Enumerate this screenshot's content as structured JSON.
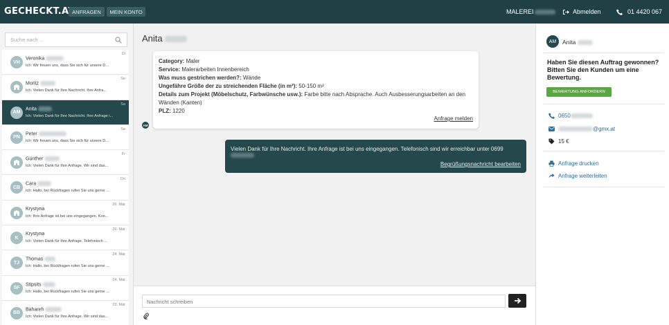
{
  "header": {
    "logo": "GECHECKT.AT",
    "nav": [
      "ANFRAGEN",
      "MEIN KONTO"
    ],
    "company_prefix": "MALEREI",
    "logout_label": "Abmelden",
    "phone": "01 4420 067"
  },
  "sidebar": {
    "search_placeholder": "Suche nach ...",
    "items": [
      {
        "initials": "VH",
        "name": "Veronika",
        "preview": "Ich: Wir freuen uns, dass Sie sich für unsere D...",
        "date": "Di",
        "avatar": "initials"
      },
      {
        "initials": "",
        "name": "Moritz",
        "preview": "Ich: Vielen Dank für Ihre Nachricht. Ihre Anfra...",
        "date": "So",
        "avatar": "building-icon"
      },
      {
        "initials": "AM",
        "name": "Anita",
        "preview": "Ich: Vielen Dank für Ihre Nachricht. Ihre Anfrage i...",
        "date": "Sa",
        "avatar": "initials",
        "active": true
      },
      {
        "initials": "PN",
        "name": "Peter",
        "preview": "Ich: Wir freuen uns, dass Sie sich für unsere D...",
        "date": "Sa",
        "avatar": "initials"
      },
      {
        "initials": "",
        "name": "Günther",
        "preview": "Ich: Vielen Dank für Ihre Anfrage. Wir sind das...",
        "date": "Fr",
        "avatar": "building-icon"
      },
      {
        "initials": "CB",
        "name": "Cara",
        "preview": "Ich: Hallo, bei Rückfragen rufen Sie uns gerne ...",
        "date": "Do",
        "avatar": "initials"
      },
      {
        "initials": "",
        "name": "Krystyna",
        "preview": "Ich: Ihre Anfrage ist bei uns eingegangen. Kon...",
        "date": "26. Mär",
        "avatar": "building-icon"
      },
      {
        "initials": "K",
        "name": "Krystyna",
        "preview": "Ich: Vielen Dank für Ihre Anfrage. Telefonisch ...",
        "date": "26. Mär",
        "avatar": "initials"
      },
      {
        "initials": "TJ",
        "name": "Thomas",
        "preview": "Ich: Hallo, bei Rückfragen rufen Sie uns gerne ...",
        "date": "24. Mär",
        "avatar": "initials"
      },
      {
        "initials": "SF",
        "name": "Stipsits",
        "preview": "Ich: Hallo, bei Rückfragen rufen Sie uns gerne ...",
        "date": "24. Mär",
        "avatar": "initials"
      },
      {
        "initials": "BB",
        "name": "Bahareh",
        "preview": "Ich: Vielen Dank für Ihre Anfrage. Wir sind das...",
        "date": "23. Mär",
        "avatar": "initials"
      }
    ]
  },
  "conversation": {
    "title": "Anita",
    "request": {
      "category_label": "Category:",
      "category_value": "Maler",
      "service_label": "Service:",
      "service_value": "Malerarbeiten Innenbereich",
      "what_label": "Was muss gestrichen werden?:",
      "what_value": "Wände",
      "area_label": "Ungefähre Größe der zu streichenden Fläche (in m²):",
      "area_value": "50-150 m²",
      "details_label": "Details zum Projekt (Möbelschutz, Farbwünsche usw.):",
      "details_value": "Farbe bitte nach Absprache. Auch Ausbesserungsarbeiten an den Wänden (Kanten)",
      "plz_label": "PLZ:",
      "plz_value": "1220",
      "report_link": "Anfrage melden"
    },
    "sender_initials": "AM",
    "reply": {
      "text": "Vielen Dank für Ihre Nachricht. Ihre Anfrage ist bei uns eingegangen. Telefonisch sind wir erreichbar unter 0699",
      "edit_link": "Begrüßungsnachricht bearbeiten"
    },
    "composer_placeholder": "Nachricht schreiben"
  },
  "details": {
    "initials": "AM",
    "name": "Anita",
    "review_question": "Haben Sie diesen Auftrag gewonnen? Bitten Sie den Kunden um eine Bewertung.",
    "review_button": "BEWERTUNG ANFORDERN",
    "phone_prefix": "0650",
    "email_suffix": "@gmx.at",
    "price": "15 €",
    "print_label": "Anfrage drucken",
    "forward_label": "Anfrage weiterleiten"
  },
  "colors": {
    "header": "#1f4145",
    "active": "#24484c",
    "green": "#5aa642",
    "link": "#2b6e9a"
  }
}
